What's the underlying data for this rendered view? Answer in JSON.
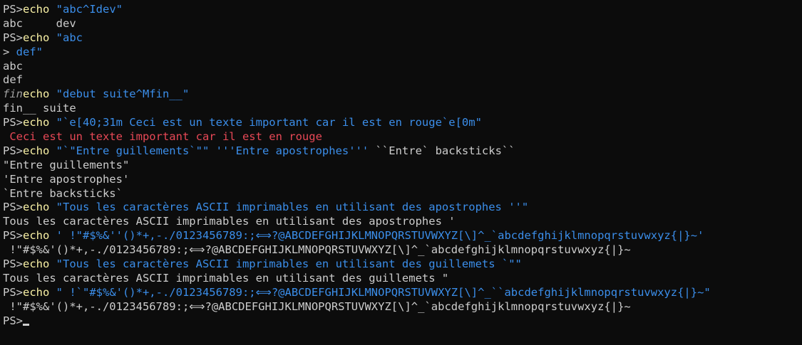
{
  "terminal": {
    "colors": {
      "background": "#0c0c0c",
      "foreground": "#cccccc",
      "command": "#f9f1a5",
      "string": "#3b8eea",
      "error_red": "#e74856"
    },
    "lines": [
      {
        "prompt": "PS>",
        "cmd": "echo",
        "str": " \"abc^Idev\""
      },
      {
        "out": "abc     dev"
      },
      {
        "prompt": "PS>",
        "cmd": "echo",
        "str": " \"abc"
      },
      {
        "prompt2": "> ",
        "str": "def\""
      },
      {
        "out": "abc"
      },
      {
        "out": "def"
      },
      {
        "italic": "fin",
        "cmd": "echo",
        "str": " \"debut suite^Mfin__\""
      },
      {
        "out": "fin__ suite"
      },
      {
        "prompt": "PS>",
        "cmd": "echo",
        "str": " \"`e[40;31m Ceci est un texte important car il est en rouge`e[0m\""
      },
      {
        "red": " Ceci est un texte important car il est en rouge"
      },
      {
        "prompt": "PS>",
        "cmd": "echo",
        "str": " \"`\"Entre guillements`\"\" '''Entre apostrophes'''",
        "rest": " ``Entre` backsticks``"
      },
      {
        "out": "\"Entre guillements\""
      },
      {
        "out": "'Entre apostrophes'"
      },
      {
        "out": "`Entre backsticks`"
      },
      {
        "prompt": "PS>",
        "cmd": "echo",
        "str": " \"Tous les caractères ASCII imprimables en utilisant des apostrophes ''\""
      },
      {
        "out": "Tous les caractères ASCII imprimables en utilisant des apostrophes '"
      },
      {
        "prompt": "PS>",
        "cmd": "echo",
        "str": " ' !\"#$%&''()*+,-./0123456789:;⟺?@ABCDEFGHIJKLMNOPQRSTUVWXYZ[\\]^_`abcdefghijklmnopqrstuvwxyz{|}~'"
      },
      {
        "out": " !\"#$%&'()*+,-./0123456789:;⟺?@ABCDEFGHIJKLMNOPQRSTUVWXYZ[\\]^_`abcdefghijklmnopqrstuvwxyz{|}~"
      },
      {
        "prompt": "PS>",
        "cmd": "echo",
        "str": " \"Tous les caractères ASCII imprimables en utilisant des guillemets `\"\""
      },
      {
        "out": "Tous les caractères ASCII imprimables en utilisant des guillemets \""
      },
      {
        "prompt": "PS>",
        "cmd": "echo",
        "str": " \" !`\"#$%&'()*+,-./0123456789:;⟺?@ABCDEFGHIJKLMNOPQRSTUVWXYZ[\\]^_``abcdefghijklmnopqrstuvwxyz{|}~\""
      },
      {
        "out": " !\"#$%&'()*+,-./0123456789:;⟺?@ABCDEFGHIJKLMNOPQRSTUVWXYZ[\\]^_`abcdefghijklmnopqrstuvwxyz{|}~"
      },
      {
        "prompt": "PS>",
        "cursor": true
      }
    ]
  }
}
